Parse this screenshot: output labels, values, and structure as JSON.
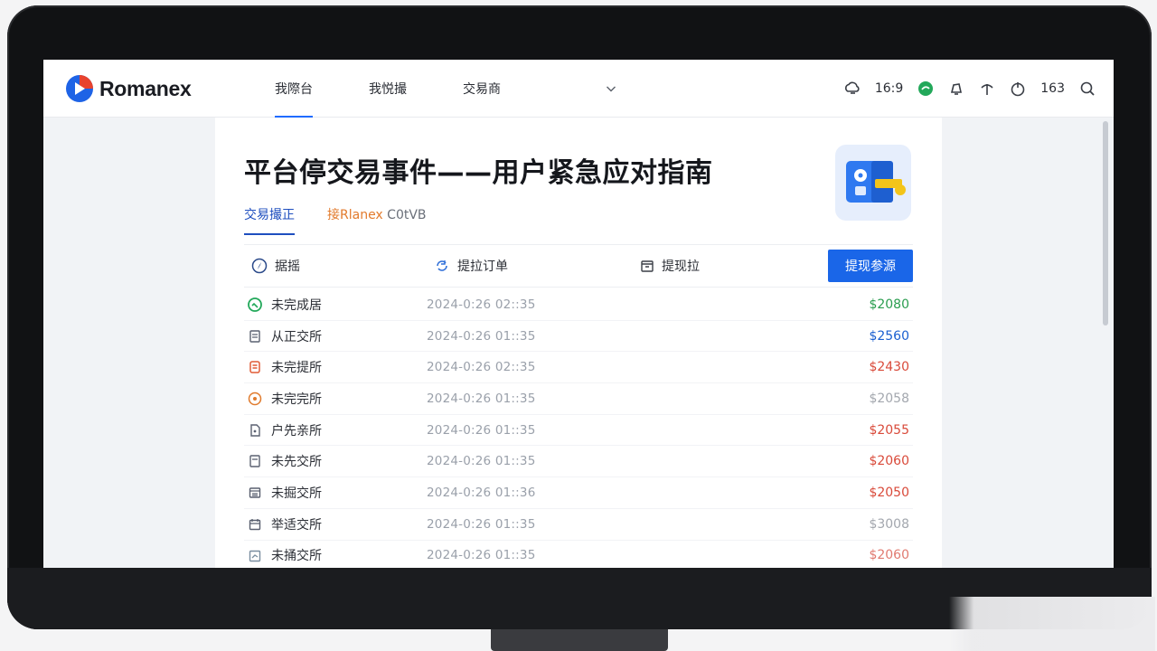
{
  "app": {
    "brand": "Romanex",
    "accent": "#1f6bff"
  },
  "nav": {
    "items": [
      {
        "label": "我際台",
        "active": true
      },
      {
        "label": "我悦撮",
        "active": false
      },
      {
        "label": "交易商",
        "active": false
      }
    ],
    "right": {
      "value_1": "16:9",
      "value_2": "163"
    },
    "icons": [
      "cloud-sync-icon",
      "chat-bubble-icon",
      "bell-icon",
      "antenna-icon",
      "power-icon",
      "search-icon"
    ]
  },
  "page": {
    "title": "平台停交易事件——用户紧急应对指南",
    "tabs": [
      {
        "label": "交易撮正",
        "active": true
      },
      {
        "label_orange": "接Rlanex",
        "label_gray": " C0tVB",
        "active": false
      }
    ]
  },
  "toolbar": {
    "item_1": "据摇",
    "item_2": "提拉订单",
    "item_3": "提现拉",
    "primary_button": "提现参源"
  },
  "rows": [
    {
      "label": "未完成居",
      "time": "2024-0:26 02::35",
      "amount": "$2080",
      "color": "#2a9d4f",
      "icon": "check-circle-icon"
    },
    {
      "label": "从正交所",
      "time": "2024-0:26 01::35",
      "amount": "$2560",
      "color": "#1a5fd0",
      "icon": "document-icon"
    },
    {
      "label": "未完提所",
      "time": "2024-0:26 02::35",
      "amount": "$2430",
      "color": "#d94a3a",
      "icon": "list-icon"
    },
    {
      "label": "未完完所",
      "time": "2024-0:26 01::35",
      "amount": "$2058",
      "color": "#a3a7ae",
      "icon": "target-icon"
    },
    {
      "label": "户先亲所",
      "time": "2024-0:26 01::35",
      "amount": "$2055",
      "color": "#d94a3a",
      "icon": "lock-file-icon"
    },
    {
      "label": "未先交所",
      "time": "2024-0:26 01::35",
      "amount": "$2060",
      "color": "#d94a3a",
      "icon": "page-icon"
    },
    {
      "label": "未掘交所",
      "time": "2024-0:26 01::36",
      "amount": "$2050",
      "color": "#d94a3a",
      "icon": "receipt-icon"
    },
    {
      "label": "举适交所",
      "time": "2024-0:26 01::35",
      "amount": "$3008",
      "color": "#a3a7ae",
      "icon": "calendar-icon"
    },
    {
      "label": "未捅交所",
      "time": "2024-0:26 01::35",
      "amount": "$2060",
      "color": "#e07a70",
      "icon": "chart-icon"
    }
  ]
}
